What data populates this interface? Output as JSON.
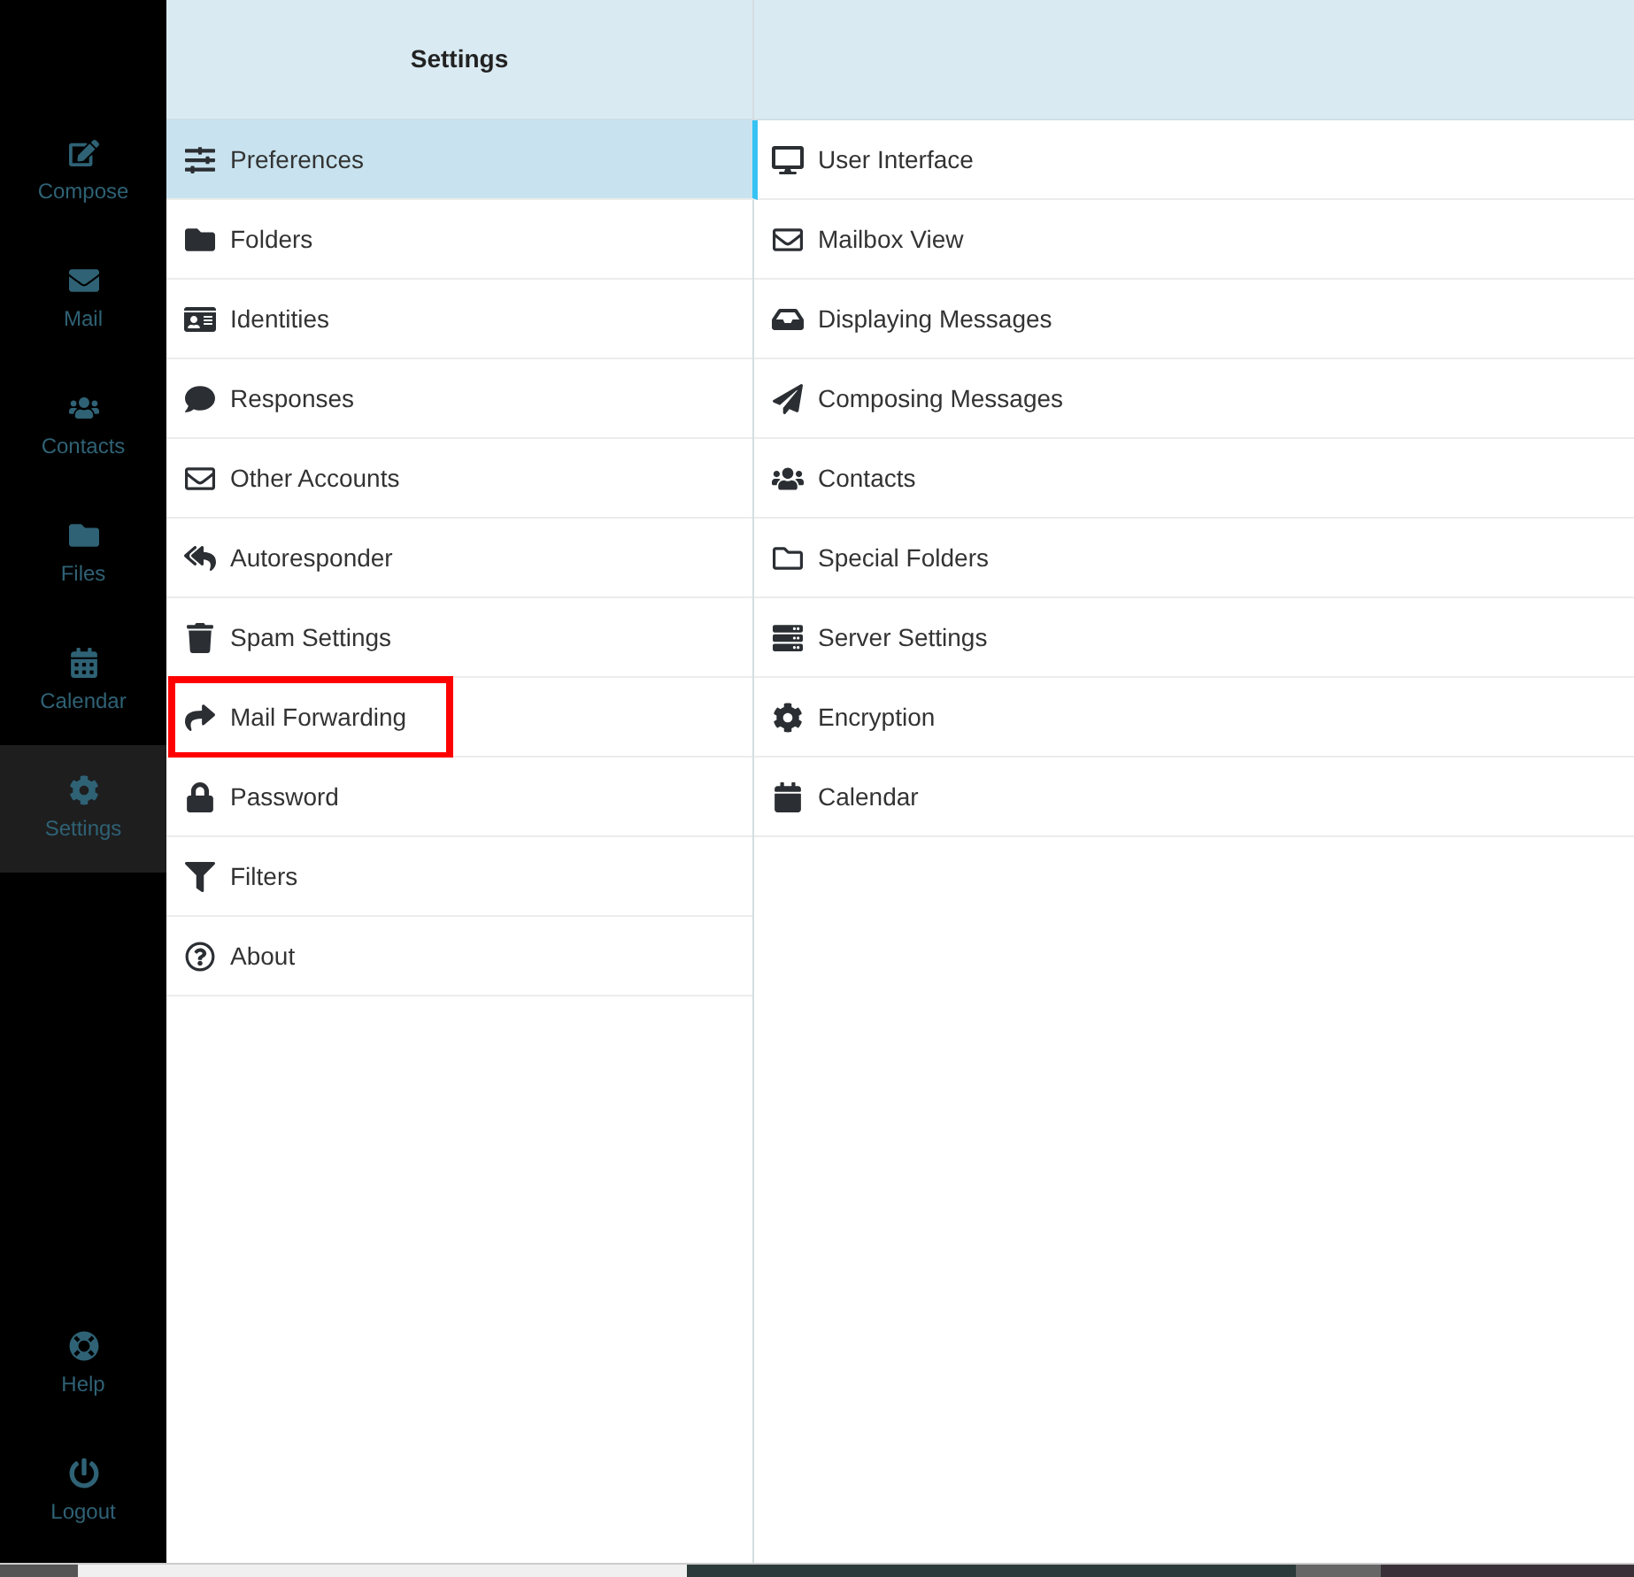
{
  "nav": {
    "items": [
      {
        "label": "Compose",
        "selected": false
      },
      {
        "label": "Mail",
        "selected": false
      },
      {
        "label": "Contacts",
        "selected": false
      },
      {
        "label": "Files",
        "selected": false
      },
      {
        "label": "Calendar",
        "selected": false
      },
      {
        "label": "Settings",
        "selected": true
      }
    ],
    "footer": [
      {
        "label": "Help"
      },
      {
        "label": "Logout"
      }
    ]
  },
  "sections": {
    "title": "Settings",
    "items": [
      {
        "label": "Preferences",
        "selected": true,
        "highlighted": false
      },
      {
        "label": "Folders",
        "selected": false,
        "highlighted": false
      },
      {
        "label": "Identities",
        "selected": false,
        "highlighted": false
      },
      {
        "label": "Responses",
        "selected": false,
        "highlighted": false
      },
      {
        "label": "Other Accounts",
        "selected": false,
        "highlighted": false
      },
      {
        "label": "Autoresponder",
        "selected": false,
        "highlighted": false
      },
      {
        "label": "Spam Settings",
        "selected": false,
        "highlighted": false
      },
      {
        "label": "Mail Forwarding",
        "selected": false,
        "highlighted": true
      },
      {
        "label": "Password",
        "selected": false,
        "highlighted": false
      },
      {
        "label": "Filters",
        "selected": false,
        "highlighted": false
      },
      {
        "label": "About",
        "selected": false,
        "highlighted": false
      }
    ]
  },
  "preferences": {
    "items": [
      {
        "label": "User Interface"
      },
      {
        "label": "Mailbox View"
      },
      {
        "label": "Displaying Messages"
      },
      {
        "label": "Composing Messages"
      },
      {
        "label": "Contacts"
      },
      {
        "label": "Special Folders"
      },
      {
        "label": "Server Settings"
      },
      {
        "label": "Encryption"
      },
      {
        "label": "Calendar"
      }
    ]
  }
}
